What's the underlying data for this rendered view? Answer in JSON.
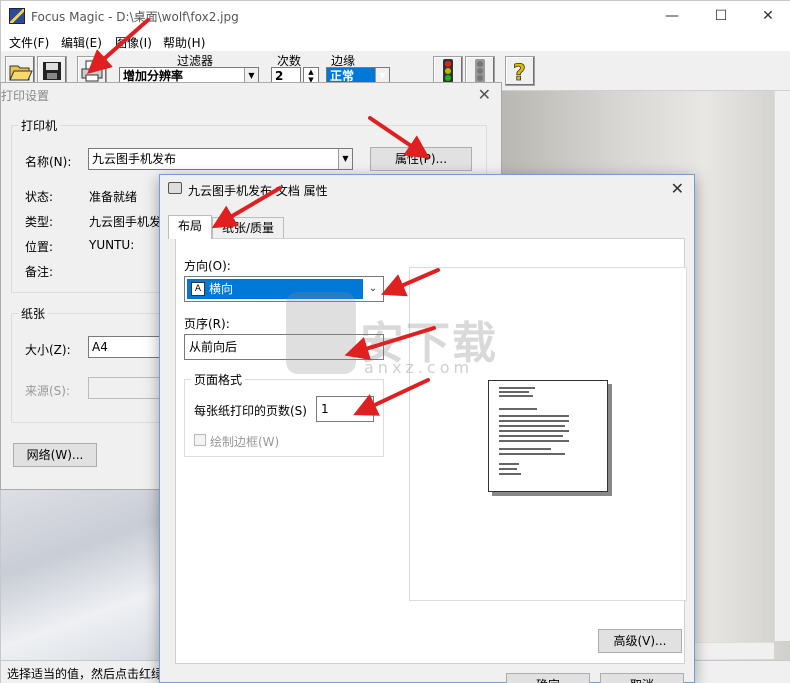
{
  "app": {
    "title": "Focus Magic - D:\\桌面\\wolf\\fox2.jpg",
    "menu": [
      "文件(F)",
      "编辑(E)",
      "图像(I)",
      "帮助(H)"
    ],
    "toolbar": {
      "filter_label": "过滤器",
      "filter_value": "增加分辨率",
      "passes_label": "次数",
      "passes_value": "2",
      "edge_label": "边缘",
      "edge_value": "正常"
    },
    "status": "选择适当的值，然后点击红绿"
  },
  "print_dialog": {
    "title": "打印设置",
    "printer_group": "打印机",
    "name_label": "名称(N):",
    "name_value": "九云图手机发布",
    "properties_button": "属性(P)...",
    "status_label": "状态:",
    "status_value": "准备就绪",
    "type_label": "类型:",
    "type_value": "九云图手机发",
    "where_label": "位置:",
    "where_value": "YUNTU:",
    "comment_label": "备注:",
    "paper_group": "纸张",
    "size_label": "大小(Z):",
    "size_value": "A4",
    "source_label": "来源(S):",
    "network_button": "网络(W)..."
  },
  "properties_dialog": {
    "title": "九云图手机发布 文档 属性",
    "tabs": [
      "布局",
      "纸张/质量"
    ],
    "orientation_label": "方向(O):",
    "orientation_value": "横向",
    "orientation_glyph": "A",
    "page_order_label": "页序(R):",
    "page_order_value": "从前向后",
    "page_format_group": "页面格式",
    "pages_per_sheet_label": "每张纸打印的页数(S)",
    "pages_per_sheet_value": "1",
    "draw_borders_label": "绘制边框(W)",
    "advanced_button": "高级(V)...",
    "ok_button": "确定",
    "cancel_button": "取消"
  },
  "watermark": {
    "text": "安下载",
    "sub": "anxz.com"
  },
  "colors": {
    "accent": "#0078d7",
    "arrow": "#e02020"
  }
}
